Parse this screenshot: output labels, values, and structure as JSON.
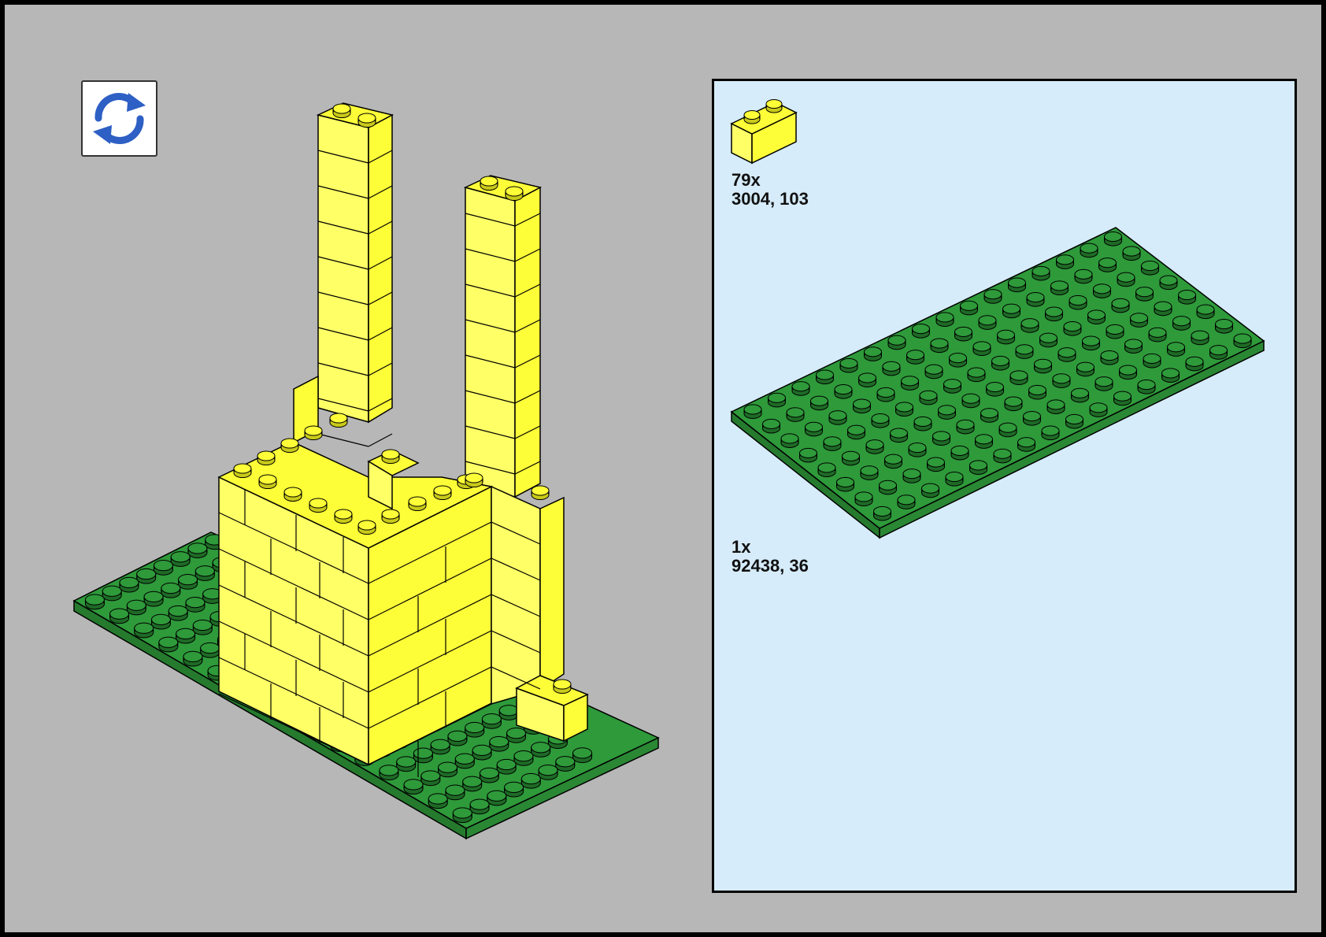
{
  "colors": {
    "background": "#b7b7b7",
    "panel_background": "#d6ecfa",
    "brick_yellow": "#fdfd38",
    "plate_green": "#2e9a3a",
    "stud_green": "#1e6a26",
    "rotate_icon": "#2d5fc4"
  },
  "toolbar": {
    "rotate_icon": "rotate-arrows-icon"
  },
  "parts_list": [
    {
      "count": "79x",
      "part": "3004, 103",
      "icon": "yellow-1x2-brick-icon"
    },
    {
      "count": "1x",
      "part": "92438, 36",
      "icon": "green-8x16-plate-icon"
    }
  ]
}
